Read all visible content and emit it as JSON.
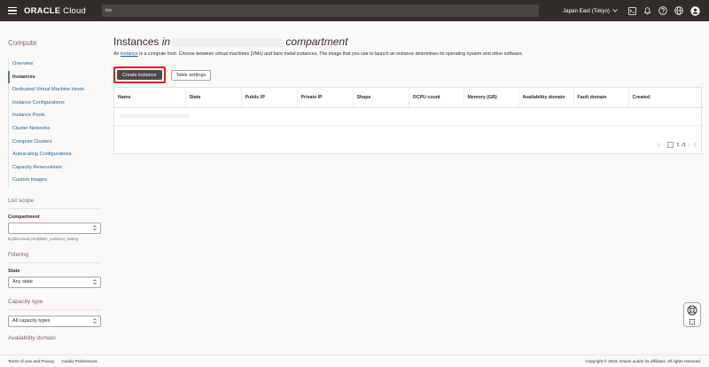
{
  "header": {
    "brand_bold": "ORACLE",
    "brand_rest": " Cloud",
    "search_value": "ins",
    "region": "Japan East (Tokyo)",
    "icons": [
      "cloud-shell-icon",
      "bell-icon",
      "help-icon",
      "globe-icon",
      "profile-icon"
    ]
  },
  "sidebar": {
    "heading": "Compute",
    "items": [
      {
        "label": "Overview",
        "active": false
      },
      {
        "label": "Instances",
        "active": true
      },
      {
        "label": "Dedicated Virtual Machine Hosts",
        "active": false
      },
      {
        "label": "Instance Configurations",
        "active": false
      },
      {
        "label": "Instance Pools",
        "active": false
      },
      {
        "label": "Cluster Networks",
        "active": false
      },
      {
        "label": "Compute Clusters",
        "active": false
      },
      {
        "label": "Autoscaling Configurations",
        "active": false
      },
      {
        "label": "Capacity Reservations",
        "active": false
      },
      {
        "label": "Custom Images",
        "active": false
      }
    ],
    "list_scope": {
      "heading": "List scope",
      "compartment_label": "Compartment",
      "compartment_value": "",
      "compartment_hint": "fcpdirect-test (root)/BBX_customer_testing"
    },
    "filtering": {
      "heading": "Filtering",
      "state_label": "State",
      "state_value": "Any state"
    },
    "capacity_type": {
      "heading": "Capacity type",
      "value": "All capacity types"
    },
    "availability_domain_heading": "Availability domain"
  },
  "main": {
    "title_prefix": "Instances",
    "title_in": " in",
    "title_suffix": " compartment",
    "desc_prefix": "An ",
    "desc_link": "instance",
    "desc_rest": " is a compute host. Choose between virtual machines (VMs) and bare metal instances. The image that you use to launch an instance determines its operating system and other software.",
    "create_button": "Create instance",
    "table_settings_button": "Table settings",
    "columns": [
      "Name",
      "State",
      "Public IP",
      "Private IP",
      "Shape",
      "OCPU count",
      "Memory (GB)",
      "Availability domain",
      "Fault domain",
      "Created"
    ],
    "pager": {
      "current": "1",
      "total": "/1"
    }
  },
  "footer": {
    "terms": "Terms of Use and Privacy",
    "cookies": "Cookie Preferences",
    "copyright": "Copyright © 2023, Oracle and/or its affiliates. All rights reserved."
  },
  "colors": {
    "topbar": "#312d2a",
    "link": "#1e5f8a",
    "highlight": "#e01c22",
    "primary_button": "#4c4a48"
  }
}
